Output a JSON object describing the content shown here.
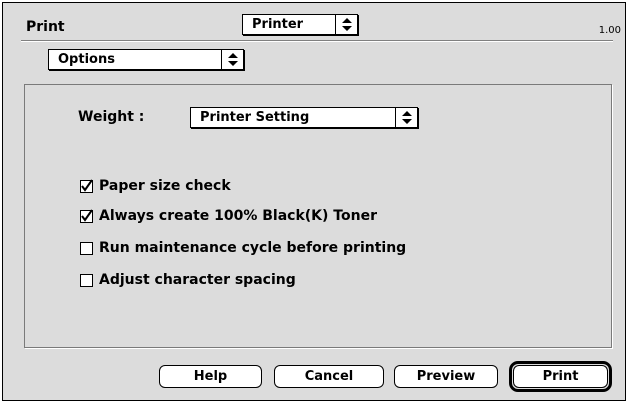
{
  "window": {
    "title": "Print",
    "version": "1.00"
  },
  "printer_popup": {
    "value": "Printer"
  },
  "panel_popup": {
    "value": "Options"
  },
  "weight": {
    "label": "Weight :",
    "value": "Printer Setting"
  },
  "checkboxes": [
    {
      "label": "Paper size check",
      "checked": true
    },
    {
      "label": "Always create 100% Black(K) Toner",
      "checked": true
    },
    {
      "label": "Run maintenance cycle before printing",
      "checked": false
    },
    {
      "label": "Adjust character spacing",
      "checked": false
    }
  ],
  "buttons": {
    "help": "Help",
    "cancel": "Cancel",
    "preview": "Preview",
    "print": "Print"
  },
  "icons": {
    "popup_arrows": "up-down-arrows-icon",
    "checkmark": "checkmark-icon"
  }
}
